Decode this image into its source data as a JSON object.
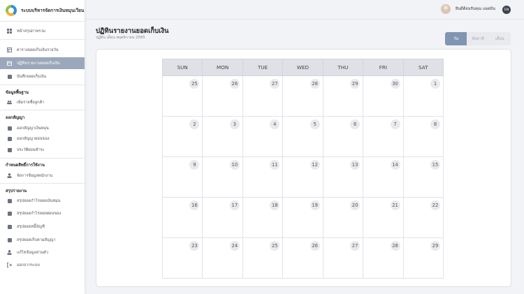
{
  "sidebar": {
    "brand": "ระบบบริหารจัดการเงินหมุนเวียน",
    "items": [
      {
        "label": "หน้าสรุปภาพรวม"
      },
      {
        "label": "ตารางยอดเก็บเงินรายวัน"
      },
      {
        "label": "ปฏิทินรายงานยอดเก็บเงิน"
      },
      {
        "label": "บันทึกยอดเก็บเงิน"
      }
    ],
    "sections": [
      {
        "title": "ข้อมูลพื้นฐาน",
        "items": [
          {
            "label": "เพิ่มรายชื่อลูกค้า"
          }
        ]
      },
      {
        "title": "ออกสัญญา",
        "items": [
          {
            "label": "ออกสัญญาเงินหมุน"
          },
          {
            "label": "ออกสัญญาผ่อนของ"
          },
          {
            "label": "ประวัติผ่อนชำระ"
          }
        ]
      },
      {
        "title": "กำหนดสิทธิ์การใช้งาน",
        "items": [
          {
            "label": "จัดการข้อมูลพนักงาน"
          }
        ]
      },
      {
        "title": "สรุปรายงาน",
        "items": [
          {
            "label": "สรุปยอดกำไรยอดเงินหมุน"
          },
          {
            "label": "สรุปยอดกำไรยอดผ่อนของ"
          },
          {
            "label": "สรุปยอดหนี้บัญชี"
          },
          {
            "label": "สรุปยอดเก็บตามสัญญา"
          }
        ]
      }
    ],
    "footer": [
      {
        "label": "แก้ไขข้อมูลส่วนตัว"
      },
      {
        "label": "ออกจากระบบ"
      }
    ]
  },
  "topbar": {
    "user_name": "ยินดีต้อนรับคุณ แอดมิน",
    "user_badge": "EN"
  },
  "header": {
    "title": "ปฏิทินรายงานยอดเก็บเงิน",
    "subtitle": "ปฏิทิน เดือน พฤศจิกายน 2565"
  },
  "view_switch": [
    {
      "label": "วัน",
      "active": true
    },
    {
      "label": "สัปดาห์",
      "active": false
    },
    {
      "label": "เดือน",
      "active": false
    }
  ],
  "calendar": {
    "weekdays": [
      "SUN",
      "MON",
      "TUE",
      "WED",
      "THU",
      "FRI",
      "SAT"
    ],
    "weeks": [
      [
        "25",
        "26",
        "27",
        "28",
        "29",
        "30",
        "1"
      ],
      [
        "2",
        "3",
        "4",
        "5",
        "6",
        "7",
        "8"
      ],
      [
        "9",
        "10",
        "11",
        "12",
        "13",
        "14",
        "15"
      ],
      [
        "16",
        "17",
        "18",
        "19",
        "20",
        "21",
        "22"
      ],
      [
        "23",
        "24",
        "25",
        "26",
        "27",
        "28",
        "29"
      ]
    ]
  },
  "colors": {
    "active_menu": "#9ba8bb",
    "active_view": "#7f95b2",
    "header_row": "#dfe1e6"
  }
}
